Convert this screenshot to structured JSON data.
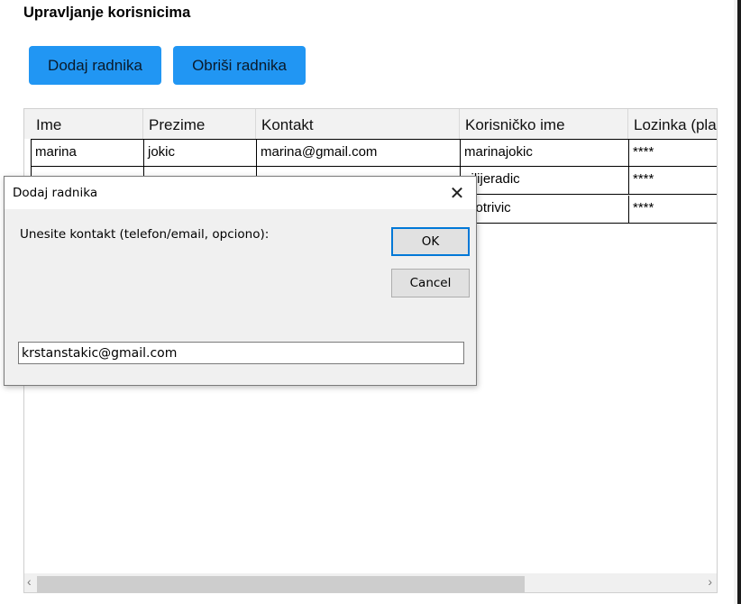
{
  "page": {
    "title": "Upravljanje korisnicima"
  },
  "toolbar": {
    "add_label": "Dodaj radnika",
    "delete_label": "Obriši radnika"
  },
  "table": {
    "columns": [
      "Ime",
      "Prezime",
      "Kontakt",
      "Korisničko ime",
      "Lozinka (pla"
    ],
    "rows": [
      [
        "marina",
        "jokic",
        "marina@gmail.com",
        "marinajokic",
        "****"
      ],
      [
        "",
        "",
        "",
        "silijeradic",
        "****"
      ],
      [
        "",
        "",
        "",
        "rkotrivic",
        "****"
      ]
    ]
  },
  "dialog": {
    "title": "Dodaj radnika",
    "prompt": "Unesite kontakt (telefon/email, opciono):",
    "ok_label": "OK",
    "cancel_label": "Cancel",
    "input_value": "krstanstakic@gmail.com",
    "close_icon": "close-icon"
  },
  "scrollbar": {
    "left_glyph": "‹",
    "right_glyph": "›"
  },
  "colors": {
    "accent": "#2196f3",
    "dialog_bg": "#f0f0f0",
    "focus": "#0078d7"
  }
}
